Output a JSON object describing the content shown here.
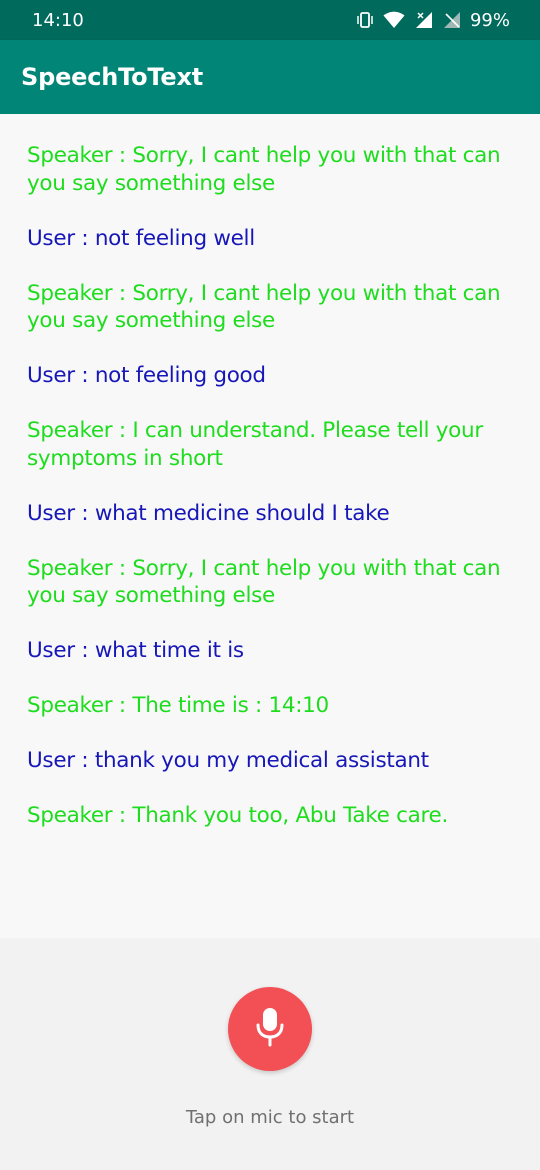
{
  "status_bar": {
    "time": "14:10",
    "battery": "99%",
    "icons": [
      "vibrate-icon",
      "wifi-icon",
      "signal-icon",
      "no-sim-icon"
    ]
  },
  "app_bar": {
    "title": "SpeechToText"
  },
  "messages": [
    {
      "role": "speaker",
      "text": "Speaker : Sorry, I cant help you with that can you say something else"
    },
    {
      "role": "user",
      "text": "User : not feeling well"
    },
    {
      "role": "speaker",
      "text": "Speaker : Sorry, I cant help you with that can you say something else"
    },
    {
      "role": "user",
      "text": "User : not feeling good"
    },
    {
      "role": "speaker",
      "text": "Speaker : I can understand. Please tell your symptoms in short"
    },
    {
      "role": "user",
      "text": "User : what medicine should I take"
    },
    {
      "role": "speaker",
      "text": "Speaker : Sorry, I cant help you with that can you say something else"
    },
    {
      "role": "user",
      "text": "User : what time it is"
    },
    {
      "role": "speaker",
      "text": "Speaker : The time is : 14:10"
    },
    {
      "role": "user",
      "text": "User : thank you my medical assistant"
    },
    {
      "role": "speaker",
      "text": "Speaker : Thank you too, Abu Take care."
    }
  ],
  "colors": {
    "speaker": "#1edc1e",
    "user": "#1717b8",
    "app_bar": "#008577",
    "status_bar": "#006b5d",
    "mic_button": "#f25054"
  },
  "mic": {
    "icon": "microphone-icon",
    "hint": "Tap on mic to start"
  }
}
